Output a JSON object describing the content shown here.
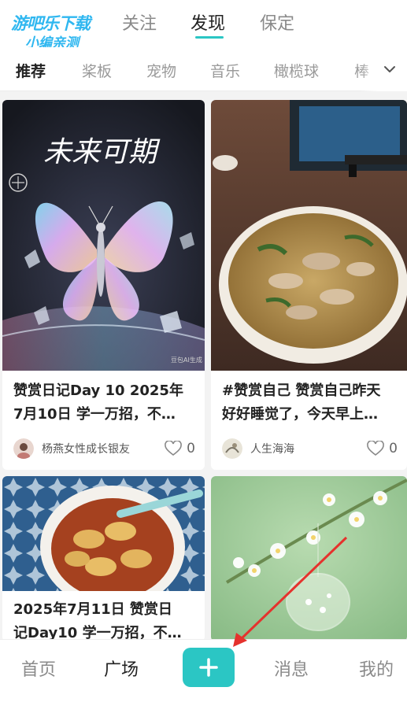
{
  "watermark": {
    "line1": "游吧乐下载",
    "line2": "小编亲测"
  },
  "top_tabs": [
    {
      "label": "关注",
      "active": false
    },
    {
      "label": "发现",
      "active": true
    },
    {
      "label": "保定",
      "active": false
    }
  ],
  "categories": [
    {
      "label": "推荐",
      "active": true
    },
    {
      "label": "桨板",
      "active": false
    },
    {
      "label": "宠物",
      "active": false
    },
    {
      "label": "音乐",
      "active": false
    },
    {
      "label": "橄榄球",
      "active": false
    },
    {
      "label": "棒",
      "active": false
    }
  ],
  "cards": [
    {
      "image_text": "未来可期",
      "image_badge": "豆包AI生成",
      "title_line1": "赞赏日记Day 10 2025年",
      "title_line2": "7月10日 学一万招，不…",
      "author": "杨燕女性成长银友",
      "likes": "0"
    },
    {
      "title_line1": "#赞赏自己 赞赏自己昨天",
      "title_line2": "好好睡觉了，今天早上…",
      "author": "人生海海",
      "likes": "0"
    },
    {
      "title_line1": "2025年7月11日 赞赏日",
      "title_line2": "记Day10 学一万招，不…"
    },
    {}
  ],
  "bottom_nav": {
    "home": "首页",
    "square": "广场",
    "messages": "消息",
    "mine": "我的"
  },
  "colors": {
    "accent": "#2bc6c4",
    "annotation_arrow": "#e5322d"
  }
}
